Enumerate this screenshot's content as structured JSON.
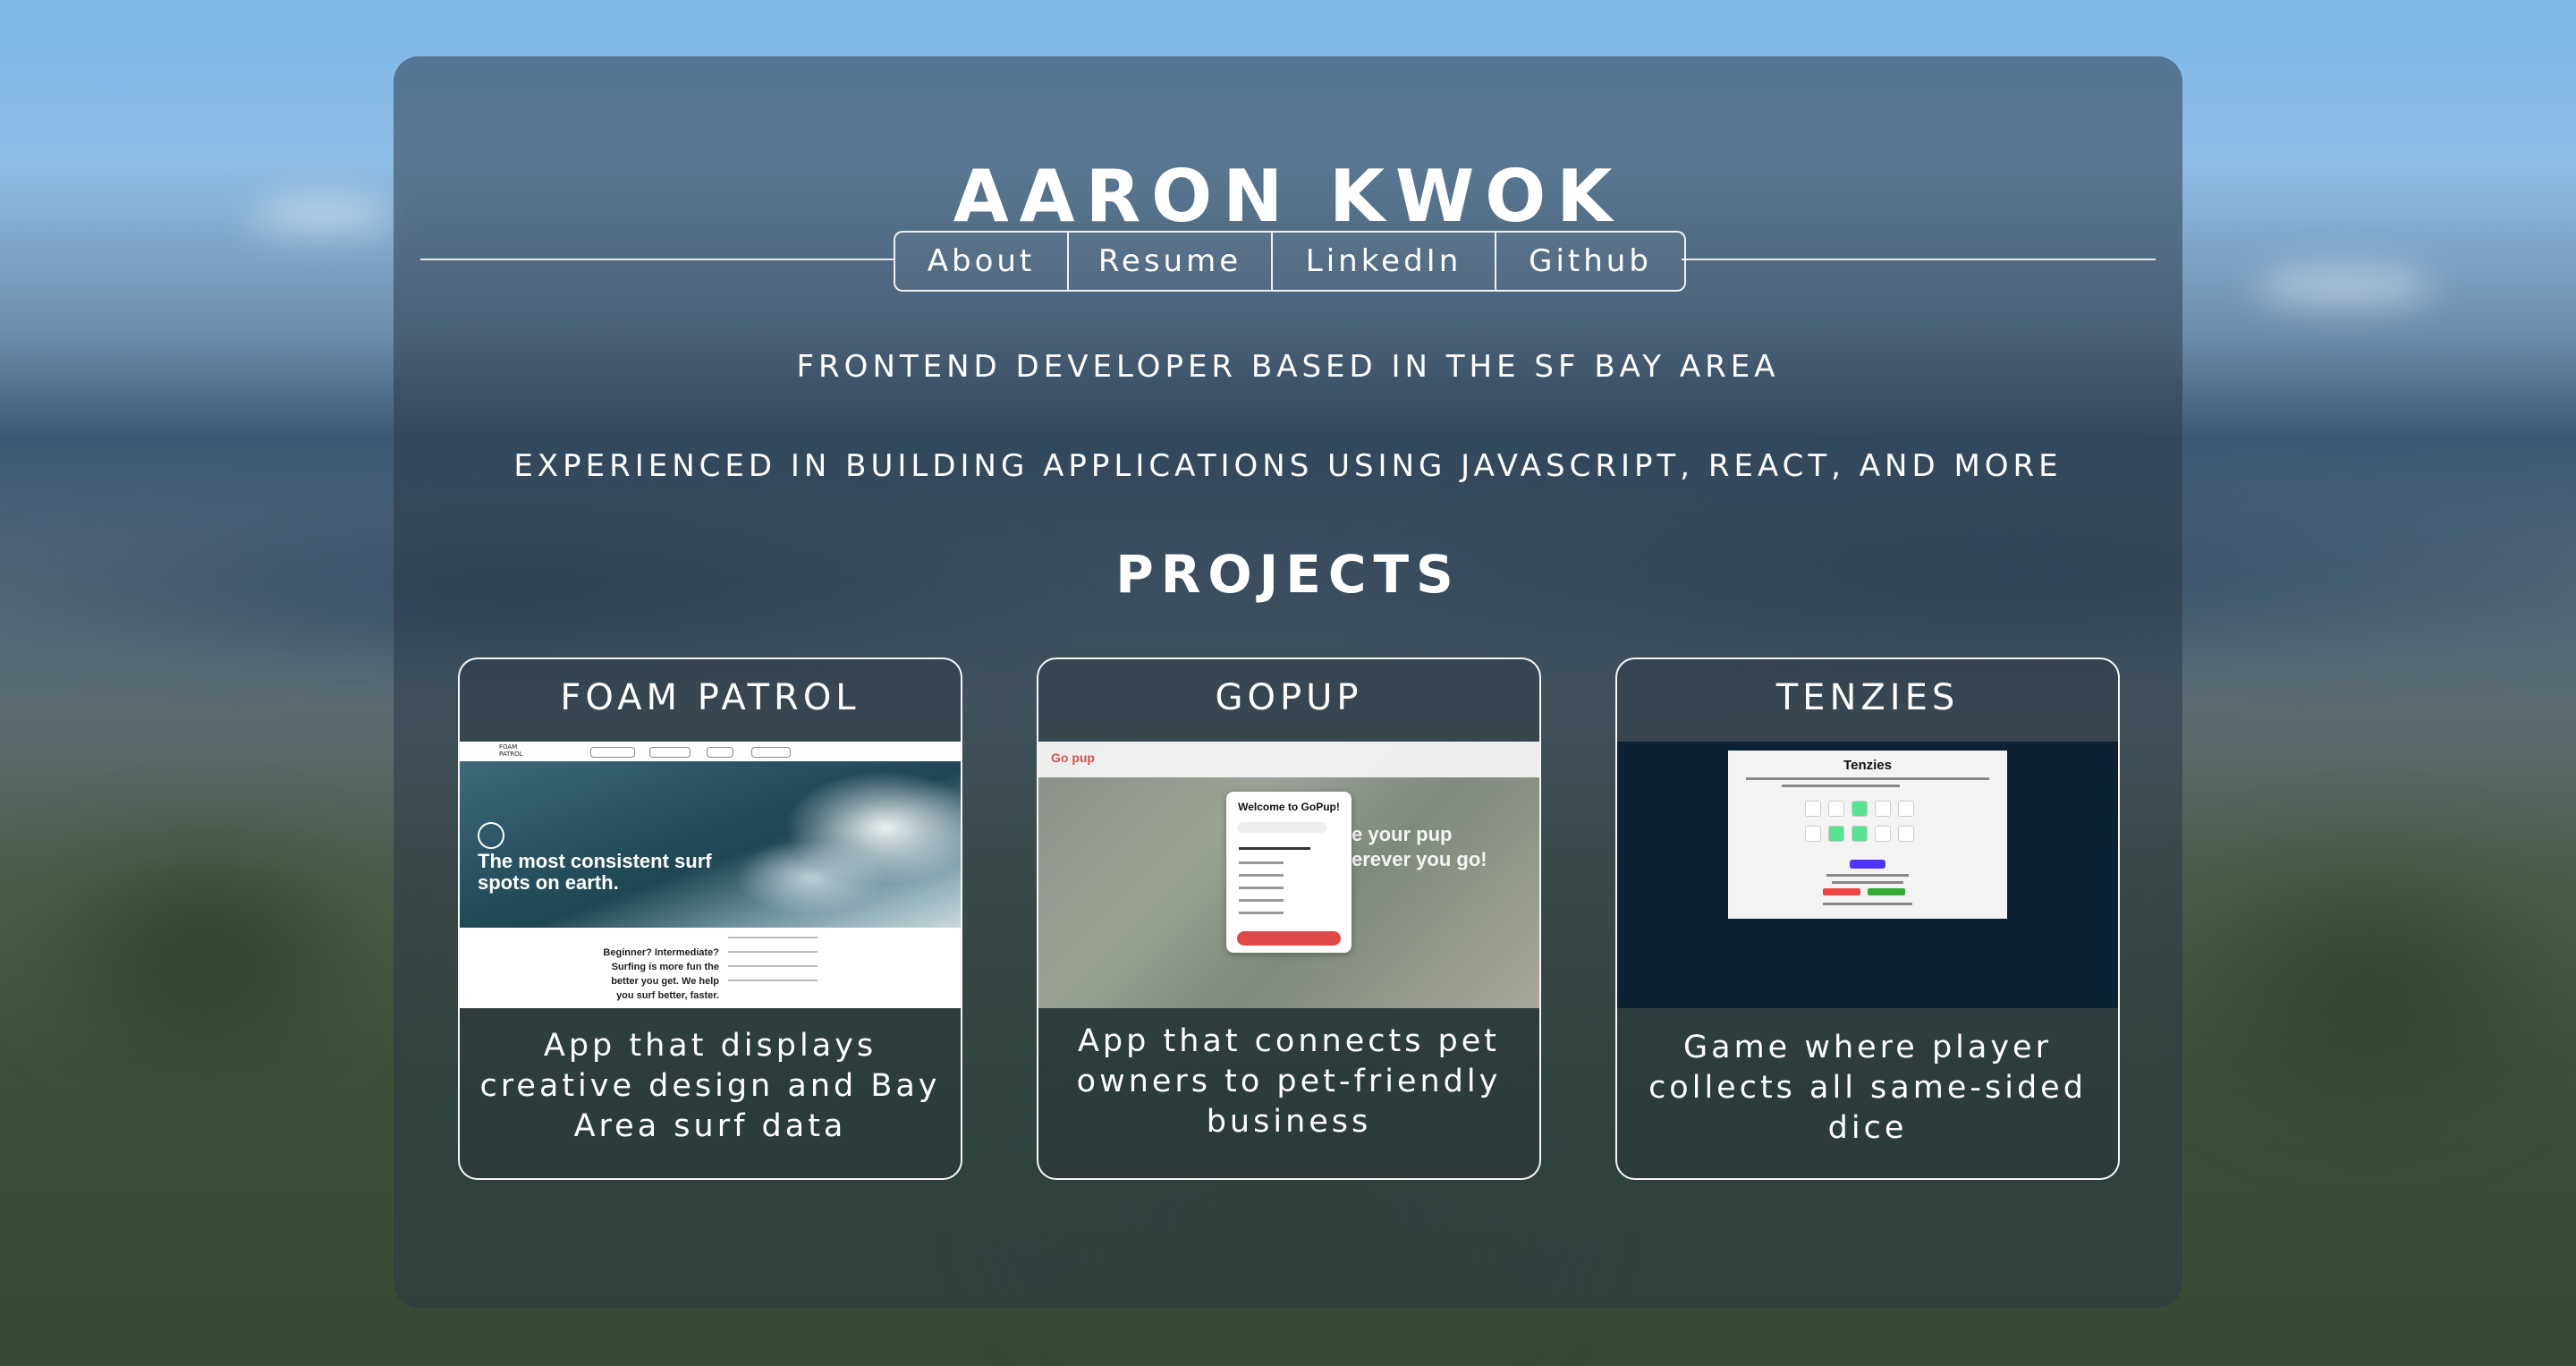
{
  "header": {
    "name": "AARON KWOK"
  },
  "nav": {
    "items": [
      "About",
      "Resume",
      "LinkedIn",
      "Github"
    ]
  },
  "taglines": {
    "line1": "FRONTEND DEVELOPER BASED IN THE SF BAY AREA",
    "line2": "EXPERIENCED IN BUILDING APPLICATIONS USING JAVASCRIPT, REACT, AND MORE"
  },
  "projects": {
    "title": "PROJECTS",
    "cards": [
      {
        "title": "FOAM PATROL",
        "description": "App that displays creative design and Bay Area surf data",
        "screenshot": {
          "hero_text": "The most consistent surf spots on earth.",
          "section_text": "Beginner? Intermediate? Surfing is more fun the better you get. We help you surf better, faster."
        }
      },
      {
        "title": "GOPUP",
        "description": "App that connects pet owners to pet-friendly business",
        "screenshot": {
          "logo": "Go pup",
          "modal_title": "Welcome to GoPup!",
          "overlay_text": "e your pup erever you go!"
        }
      },
      {
        "title": "TENZIES",
        "description": "Game where player collects all same-sided dice",
        "screenshot": {
          "game_title": "Tenzies"
        }
      }
    ]
  },
  "colors": {
    "panel": "#283746",
    "text": "#ffffff",
    "tenzies_bg": "#0c2233",
    "gopup_button": "#e04848",
    "tenzies_roll": "#5035ff",
    "tenzies_held": "#59e391"
  }
}
